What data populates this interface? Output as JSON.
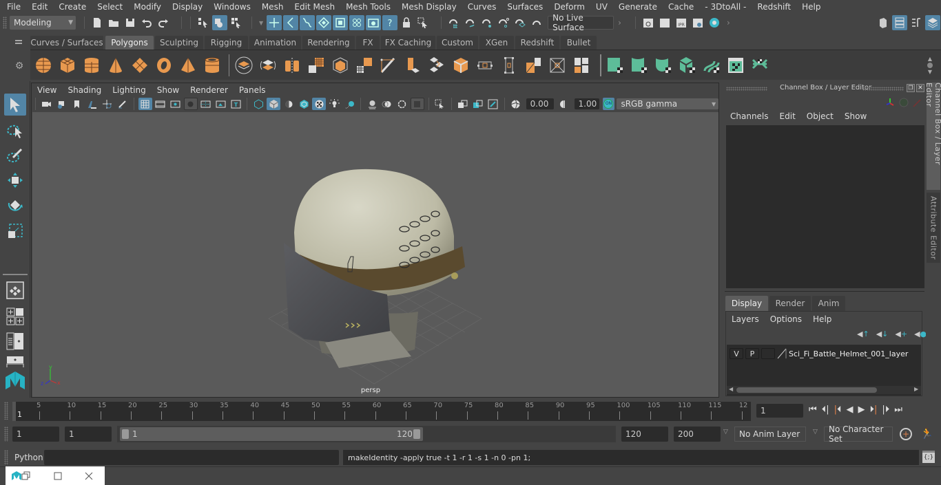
{
  "menubar": {
    "items": [
      "File",
      "Edit",
      "Create",
      "Select",
      "Modify",
      "Display",
      "Windows",
      "Mesh",
      "Edit Mesh",
      "Mesh Tools",
      "Mesh Display",
      "Curves",
      "Surfaces",
      "Deform",
      "UV",
      "Generate",
      "Cache",
      "- 3DtoAll -",
      "Redshift",
      "Help"
    ]
  },
  "statusline": {
    "mode": "Modeling",
    "live_surface": "No Live Surface"
  },
  "shelf": {
    "tabs": [
      "Curves / Surfaces",
      "Polygons",
      "Sculpting",
      "Rigging",
      "Animation",
      "Rendering",
      "FX",
      "FX Caching",
      "Custom",
      "XGen",
      "Redshift",
      "Bullet"
    ],
    "active_tab": "Polygons",
    "icons": [
      "poly-sphere-icon",
      "poly-cube-icon",
      "poly-cylinder-icon",
      "poly-cone-icon",
      "poly-plane-icon",
      "poly-torus-icon",
      "poly-pyramid-icon",
      "poly-pipe-icon",
      "combine-icon",
      "separate-icon",
      "mirror-icon",
      "smooth-icon",
      "bevel-icon",
      "bridge-icon",
      "multi-cut-icon",
      "extrude-icon",
      "append-polygon-icon",
      "fill-hole-icon",
      "cube-uv-icon",
      "merge-vertex-icon",
      "insert-edge-loop-icon",
      "target-weld-icon",
      "boolean-icon",
      "reduce-icon",
      "planar-uv-icon",
      "cylindrical-uv-icon",
      "spherical-uv-icon",
      "automatic-uv-icon",
      "unfold-icon",
      "uv-editor-icon",
      "uv-layout-icon"
    ]
  },
  "viewport": {
    "menu": [
      "View",
      "Shading",
      "Lighting",
      "Show",
      "Renderer",
      "Panels"
    ],
    "exposure": "0.00",
    "gamma": "1.00",
    "color_mgmt_label": "ON",
    "color_space": "sRGB gamma",
    "camera_label": "persp",
    "axis": {
      "x": "x",
      "y": "y",
      "z": "z"
    }
  },
  "channelbox": {
    "title": "Channel Box / Layer Editor",
    "menu": [
      "Channels",
      "Edit",
      "Object",
      "Show"
    ]
  },
  "layer_editor": {
    "tabs": [
      "Display",
      "Render",
      "Anim"
    ],
    "active_tab": "Display",
    "menu": [
      "Layers",
      "Options",
      "Help"
    ],
    "layers": [
      {
        "v": "V",
        "p": "P",
        "name": "Sci_Fi_Battle_Helmet_001_layer"
      }
    ]
  },
  "sidetabs": [
    "Channel Box / Layer Editor",
    "Attribute Editor"
  ],
  "timeline": {
    "ticks": [
      "5",
      "10",
      "15",
      "20",
      "25",
      "30",
      "35",
      "40",
      "45",
      "50",
      "55",
      "60",
      "65",
      "70",
      "75",
      "80",
      "85",
      "90",
      "95",
      "100",
      "105",
      "110",
      "115",
      "12"
    ],
    "current_marker": "1",
    "current_frame": "1"
  },
  "range": {
    "start": "1",
    "playback_start": "1",
    "slider_min": "1",
    "slider_max": "120",
    "playback_end": "120",
    "end": "200",
    "anim_layer": "No Anim Layer",
    "character_set": "No Character Set"
  },
  "cmdline": {
    "language": "Python",
    "input": "",
    "output": "makeIdentity -apply true -t 1 -r 1 -s 1 -n 0 -pn 1;"
  },
  "colors": {
    "accent_blue": "#5285a6",
    "shelf_orange": "#e8994f",
    "shelf_green": "#5dbd99",
    "maya_teal": "#27b3c4",
    "key_orange": "#e0804a"
  }
}
